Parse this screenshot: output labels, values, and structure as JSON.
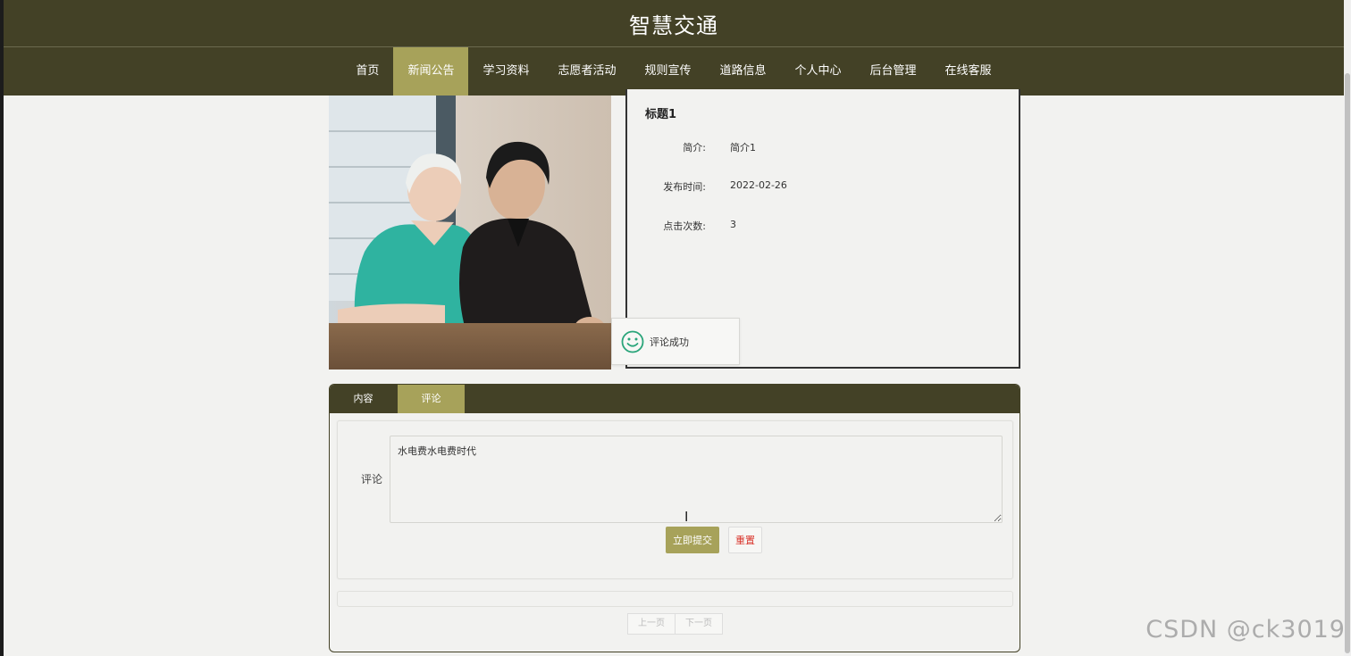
{
  "site": {
    "title": "智慧交通"
  },
  "nav": {
    "items": [
      {
        "label": "首页"
      },
      {
        "label": "新闻公告",
        "active": true
      },
      {
        "label": "学习资料"
      },
      {
        "label": "志愿者活动"
      },
      {
        "label": "规则宣传"
      },
      {
        "label": "道路信息"
      },
      {
        "label": "个人中心"
      },
      {
        "label": "后台管理"
      },
      {
        "label": "在线客服"
      }
    ]
  },
  "detail": {
    "title": "标题1",
    "fields": [
      {
        "label": "简介:",
        "value": "简介1"
      },
      {
        "label": "发布时间:",
        "value": "2022-02-26"
      },
      {
        "label": "点击次数:",
        "value": "3"
      }
    ]
  },
  "toast": {
    "text": "评论成功",
    "icon": "smiley-icon",
    "color": "#2aa57a"
  },
  "tabs": [
    {
      "label": "内容"
    },
    {
      "label": "评论",
      "active": true
    }
  ],
  "comment_form": {
    "label": "评论",
    "value": "水电费水电费时代",
    "submit_label": "立即提交",
    "reset_label": "重置"
  },
  "pager": {
    "prev": "上一页",
    "next": "下一页"
  },
  "watermark": "CSDN @ck3019",
  "colors": {
    "header": "#434126",
    "accent": "#a7a25a",
    "reset": "#d9342b"
  }
}
